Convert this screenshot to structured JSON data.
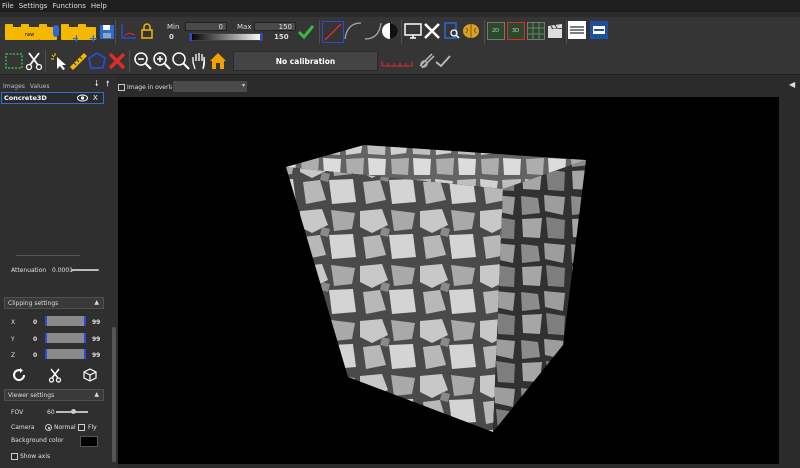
{
  "menu": {
    "items": [
      "File",
      "Settings",
      "Functions",
      "Help"
    ]
  },
  "toolbar": {
    "min_label": "Min",
    "max_label": "Max",
    "min_value": "0",
    "max_value": "150",
    "range_low": "0",
    "range_high": "150",
    "calibration_text": "No calibration",
    "btn_2d": "2D",
    "btn_3d": "3D"
  },
  "side": {
    "tab_images": "Images",
    "tab_values": "Values",
    "layer_name": "Concrete3D",
    "layer_close": "X",
    "attenuation_label": "Attenuation",
    "attenuation_value": "0.0001",
    "clipping_title": "Clipping settings",
    "clip_rows": [
      {
        "axis": "X",
        "min": "0",
        "max": "99"
      },
      {
        "axis": "Y",
        "min": "0",
        "max": "99"
      },
      {
        "axis": "Z",
        "min": "0",
        "max": "99"
      }
    ],
    "viewer_title": "Viewer settings",
    "fov_label": "FOV",
    "fov_value": "60",
    "camera_label": "Camera",
    "camera_normal": "Normal",
    "camera_fly": "Fly",
    "bgcolor_label": "Background color",
    "show_axis_label": "Show axis"
  },
  "viewer": {
    "overlay_label": "Image in overlay",
    "overlay_value": ""
  },
  "colors": {
    "accent_blue": "#2a6ad8",
    "folder_yellow": "#f5b800",
    "check_green": "#3ab54a",
    "red": "#e02a2a"
  }
}
